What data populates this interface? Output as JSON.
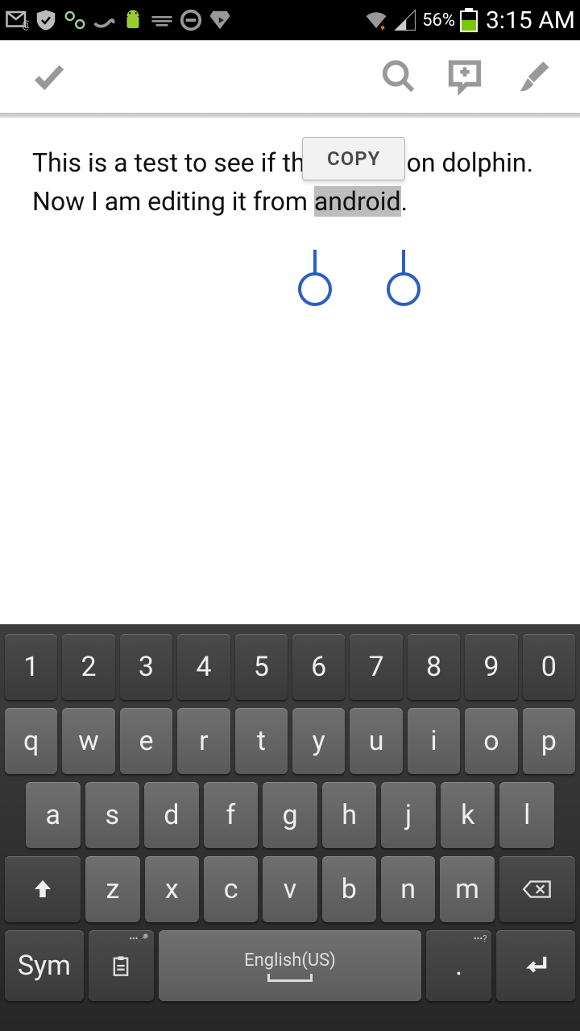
{
  "status": {
    "battery_pct": "56%",
    "time": "3:15 AM"
  },
  "context_menu": {
    "copy": "COPY"
  },
  "note": {
    "line1_a": "This is a test to see if this works on dolphin.",
    "line2_a": "Now I am editing it from ",
    "line2_sel": "android",
    "line2_b": "."
  },
  "keyboard": {
    "row_num": [
      "1",
      "2",
      "3",
      "4",
      "5",
      "6",
      "7",
      "8",
      "9",
      "0"
    ],
    "row_q": [
      "q",
      "w",
      "e",
      "r",
      "t",
      "y",
      "u",
      "i",
      "o",
      "p"
    ],
    "row_a": [
      "a",
      "s",
      "d",
      "f",
      "g",
      "h",
      "j",
      "k",
      "l"
    ],
    "row_z": [
      "z",
      "x",
      "c",
      "v",
      "b",
      "n",
      "m"
    ],
    "sym": "Sym",
    "space": "English(US)",
    "period": "."
  }
}
